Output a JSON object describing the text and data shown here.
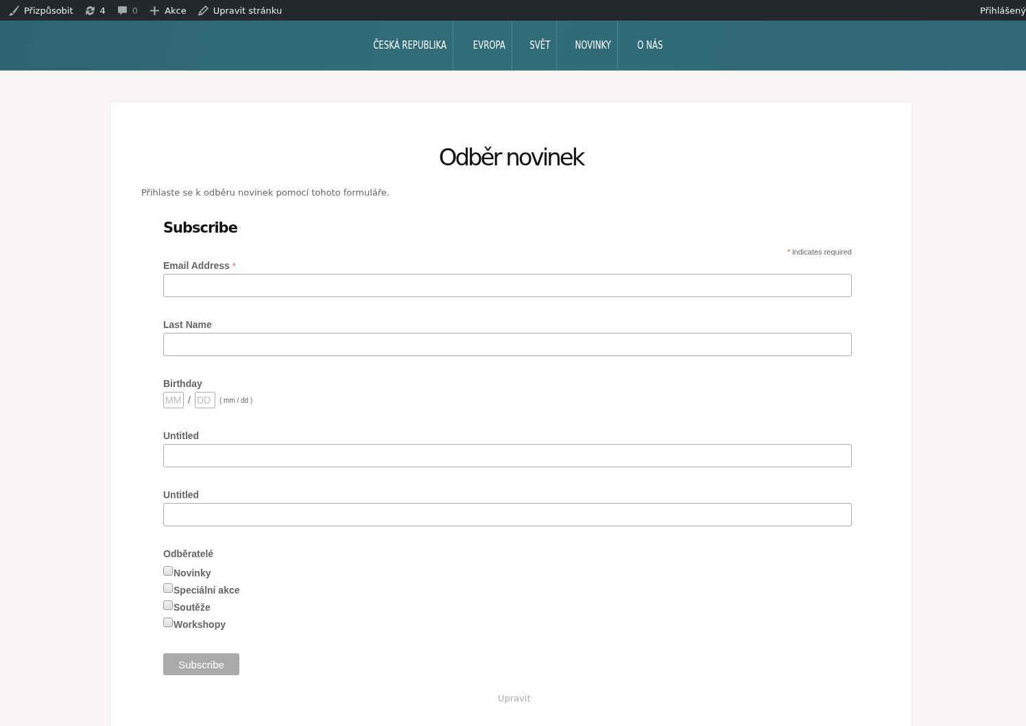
{
  "admin_bar": {
    "items": [
      {
        "label": "Přizpůsobit",
        "muted": false
      },
      {
        "label": "4",
        "muted": false
      },
      {
        "label": "0",
        "muted": true
      },
      {
        "label": "Akce",
        "muted": false
      },
      {
        "label": "Upravit stránku",
        "muted": false
      }
    ],
    "account": "Přihlášený"
  },
  "nav": [
    "ČESKÁ REPUBLIKA",
    "EVROPA",
    "SVĚT",
    "NOVINKY",
    "O NÁS"
  ],
  "page": {
    "title": "Odběr novinek",
    "intro": "Přihlaste se k odběru novinek pomocí tohoto formuláře.",
    "form": {
      "heading": "Subscribe",
      "required_note": "indicates required",
      "required_mark": "*",
      "fields": [
        {
          "kind": "text",
          "label": "Email Address",
          "required_mark": "*"
        },
        {
          "kind": "text",
          "label": "Last Name"
        },
        {
          "kind": "date",
          "label": "Birthday",
          "month_placeholder": "MM",
          "separator": "/",
          "day_placeholder": "DD",
          "hint": "( mm / dd )"
        },
        {
          "kind": "text",
          "label": "Untitled"
        },
        {
          "kind": "text",
          "label": "Untitled"
        },
        {
          "kind": "checkboxes",
          "label": "Odběratelé",
          "options": [
            {
              "label": "Novinky",
              "checked": false
            },
            {
              "label": "Speciální akce",
              "checked": false
            },
            {
              "label": "Soutěže",
              "checked": false
            },
            {
              "label": "Workshopy",
              "checked": false
            }
          ]
        }
      ],
      "submit": "Subscribe"
    },
    "edit_link": "Upravit"
  }
}
